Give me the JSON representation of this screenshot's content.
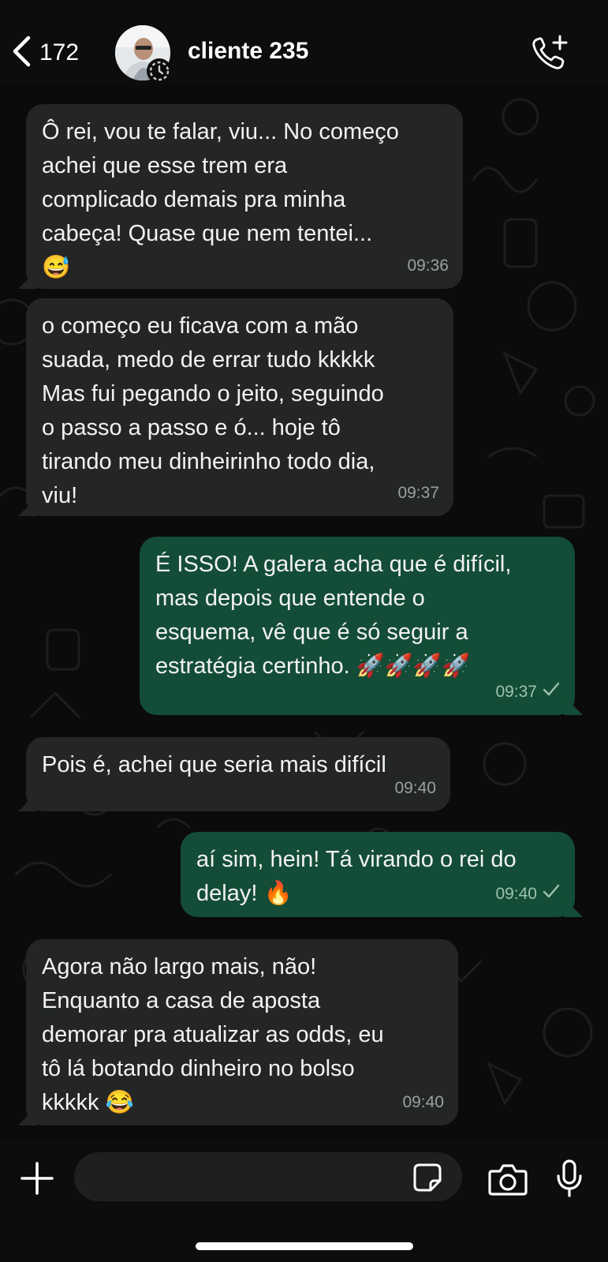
{
  "header": {
    "back_count": "172",
    "contact_name": "cliente 235"
  },
  "messages": [
    {
      "direction": "in",
      "text": "Ô rei, vou te falar, viu... No começo\nachei que esse trem era\ncomplicado demais pra minha\ncabeça! Quase que nem tentei...\n😅",
      "time": "09:36"
    },
    {
      "direction": "in",
      "text": "o começo eu ficava com a mão\nsuada, medo de errar tudo kkkkk\nMas fui pegando o jeito, seguindo\no passo a passo e ó... hoje tô\ntirando meu dinheirinho todo dia,\nviu!",
      "time": "09:37"
    },
    {
      "direction": "out",
      "text": "É ISSO! A galera acha que é difícil,\nmas depois que entende o\nesquema, vê que é só seguir a\nestratégia certinho. 🚀🚀🚀🚀",
      "time": "09:37",
      "status": "sent"
    },
    {
      "direction": "in",
      "text": "Pois é, achei que seria mais difícil",
      "time": "09:40"
    },
    {
      "direction": "out",
      "text": "aí sim, hein! Tá virando o rei do\ndelay! 🔥",
      "time": "09:40",
      "status": "sent"
    },
    {
      "direction": "in",
      "text": "Agora não largo mais, não!\nEnquanto a casa de aposta\ndemorar pra atualizar as odds, eu\ntô lá botando dinheiro no bolso\nkkkkk 😂",
      "time": "09:40"
    }
  ],
  "composer": {
    "input_value": ""
  },
  "icons": {
    "back": "chevron-left-icon",
    "call": "add-call-icon",
    "plus": "plus-icon",
    "sticker": "sticker-icon",
    "camera": "camera-icon",
    "mic": "microphone-icon",
    "check": "check-icon"
  },
  "colors": {
    "incoming_bubble": "#242626",
    "outgoing_bubble": "#144d37",
    "background": "#0b0b0b"
  }
}
